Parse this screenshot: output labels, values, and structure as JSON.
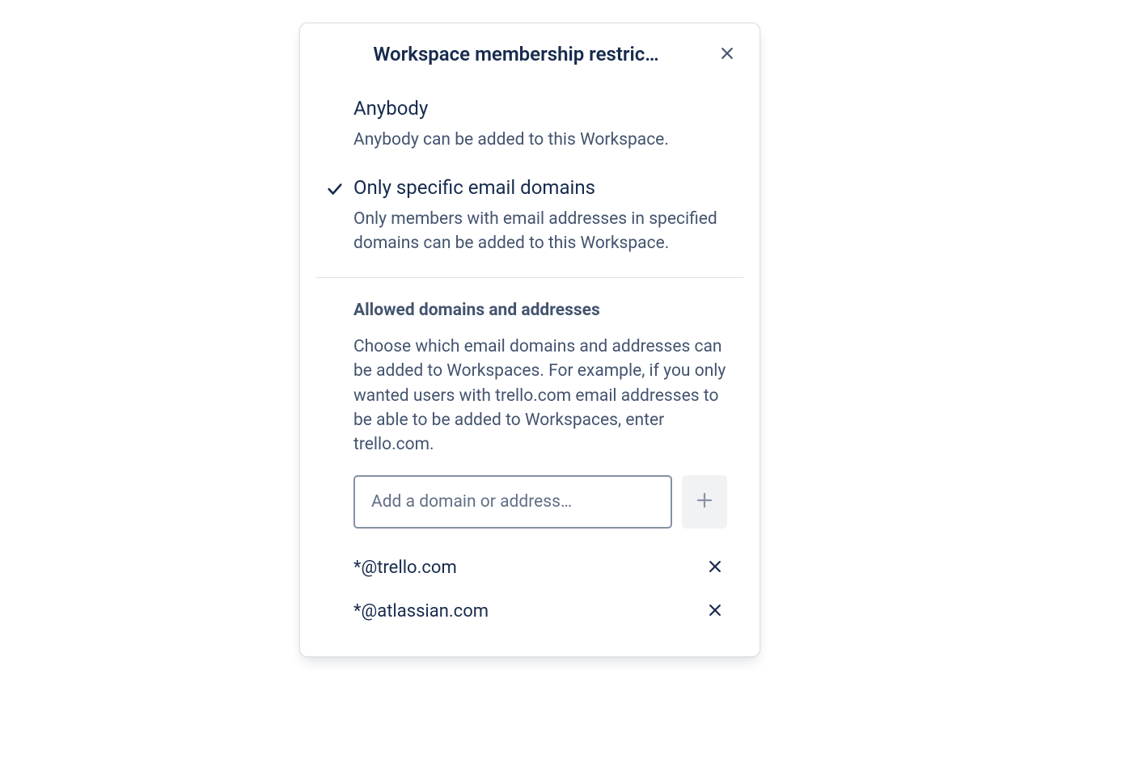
{
  "dialog": {
    "title": "Workspace membership restric…"
  },
  "options": [
    {
      "selected": false,
      "title": "Anybody",
      "desc": "Anybody can be added to this Workspace."
    },
    {
      "selected": true,
      "title": "Only specific email domains",
      "desc": "Only members with email addresses in specified domains can be added to this Workspace."
    }
  ],
  "allowed": {
    "heading": "Allowed domains and addresses",
    "desc": "Choose which email domains and addresses can be added to Workspaces. For example, if you only wanted users with trello.com email addresses to be able to be added to Workspaces, enter trello.com.",
    "input_placeholder": "Add a domain or address…",
    "domains": [
      "*@trello.com",
      "*@atlassian.com"
    ]
  }
}
